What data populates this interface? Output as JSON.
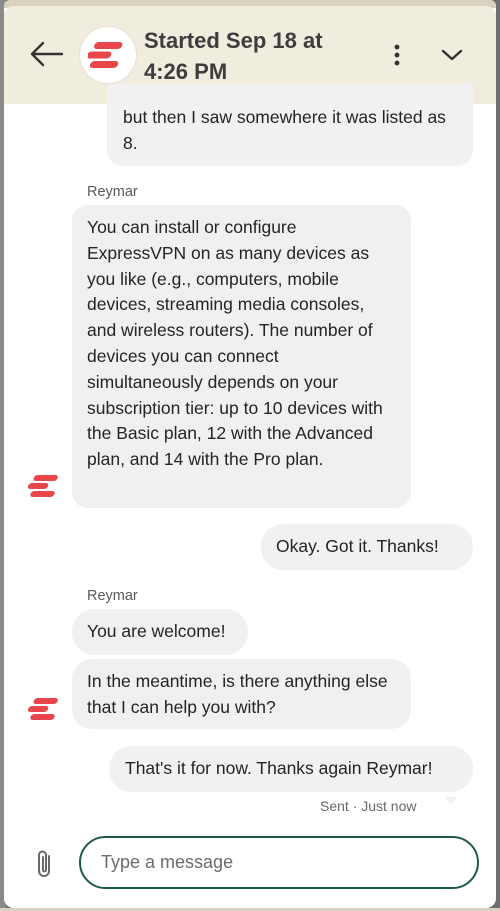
{
  "header": {
    "back_label": "Back",
    "title": "Started Sep 18 at 4:26 PM",
    "menu_label": "More options",
    "collapse_label": "Collapse"
  },
  "brand": {
    "color": "#e8464a"
  },
  "messages": [
    {
      "direction": "out",
      "text": "but then I saw somewhere it was listed as 8."
    },
    {
      "direction": "in",
      "sender": "Reymar",
      "text": "You can install or configure ExpressVPN on as many devices as you like (e.g., computers, mobile devices, streaming media consoles, and wireless routers). The number of devices you can connect simultaneously depends on your subscription tier: up to 10 devices with the Basic plan, 12 with the Advanced plan, and 14 with the Pro plan."
    },
    {
      "direction": "out",
      "text": "Okay.  Got it.  Thanks!"
    },
    {
      "direction": "in",
      "sender": "Reymar",
      "text": "You are welcome!"
    },
    {
      "direction": "in",
      "text": "In the meantime, is there anything else that I can help you with?"
    },
    {
      "direction": "out",
      "text": "That's it for now.  Thanks again Reymar!",
      "status": "Sent · Just now"
    }
  ],
  "composer": {
    "placeholder": "Type a message",
    "value": ""
  }
}
